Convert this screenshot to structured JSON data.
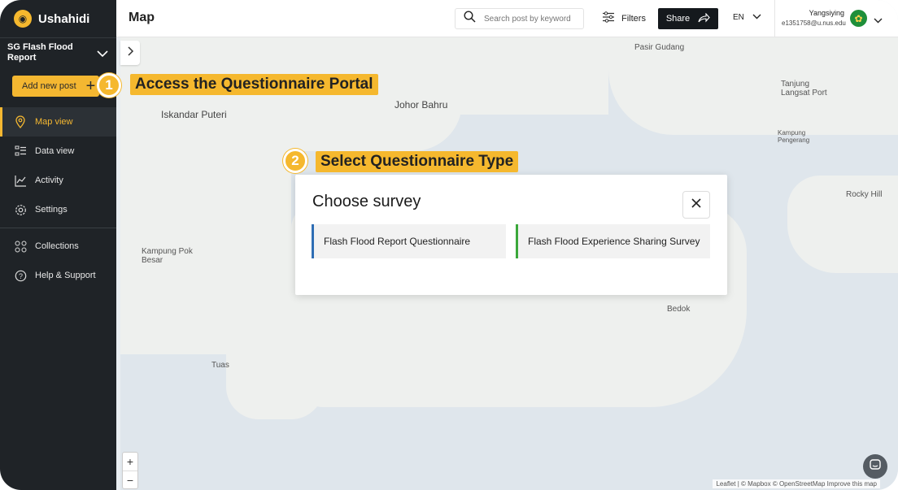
{
  "brand": {
    "name": "Ushahidi"
  },
  "deployment": {
    "title": "SG Flash Flood Report"
  },
  "sidebar": {
    "add_post_label": "Add new post",
    "items": [
      {
        "label": "Map view",
        "icon": "map-pin-icon",
        "active": true
      },
      {
        "label": "Data view",
        "icon": "list-icon"
      },
      {
        "label": "Activity",
        "icon": "activity-chart-icon"
      },
      {
        "label": "Settings",
        "icon": "gear-icon"
      },
      {
        "label": "Collections",
        "icon": "grid-icon"
      },
      {
        "label": "Help & Support",
        "icon": "help-icon"
      }
    ]
  },
  "header": {
    "title": "Map",
    "search_placeholder": "Search post by keyword",
    "filters_label": "Filters",
    "share_label": "Share",
    "language": "EN",
    "user_name": "Yangsiying",
    "user_email": "e1351758@u.nus.edu"
  },
  "annotations": [
    {
      "number": "1",
      "text": "Access the Questionnaire Portal"
    },
    {
      "number": "2",
      "text": "Select Questionnaire Type"
    }
  ],
  "modal": {
    "title": "Choose survey",
    "options": [
      {
        "label": "Flash Flood Report Questionnaire",
        "accent": "#2e6db4"
      },
      {
        "label": "Flash Flood Experience Sharing Survey",
        "accent": "#3aa83a"
      }
    ]
  },
  "map": {
    "labels": [
      "Johor Bahru",
      "Iskandar Puteri",
      "Pasir Gudang",
      "Tanjung Langsat Port",
      "Kampung Pok Besar",
      "Kampung Pengerang",
      "Rocky Hill",
      "Bedok",
      "Tuas"
    ],
    "attribution": "Leaflet | © Mapbox © OpenStreetMap Improve this map"
  },
  "colors": {
    "accent": "#f5b82e",
    "sidebar_bg": "#1f2327"
  }
}
